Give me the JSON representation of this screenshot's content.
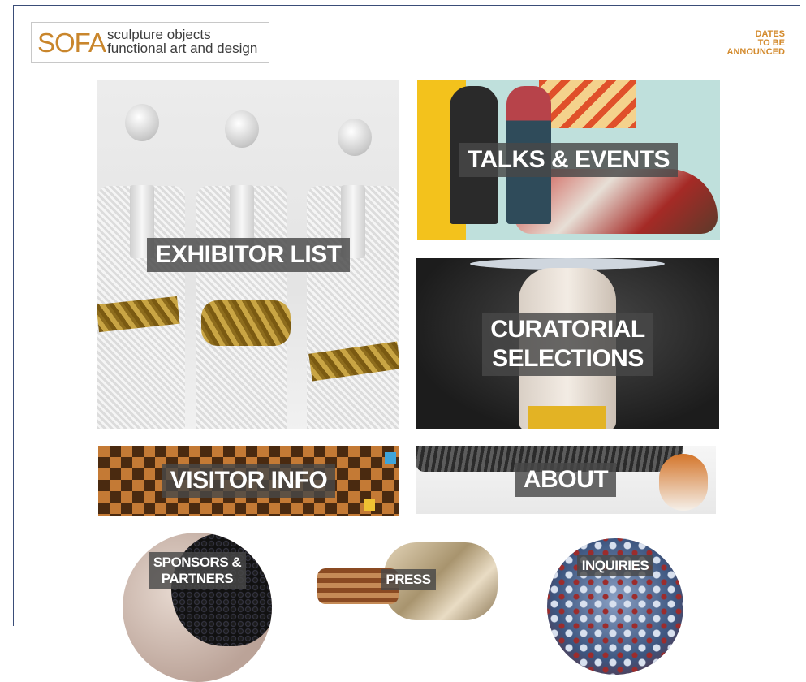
{
  "logo": {
    "mark": "SOFA",
    "tagline": "sculpture objects\nfunctional art and design"
  },
  "dates_notice": "DATES\nTO BE\nANNOUNCED",
  "tiles": {
    "exhibitor_list": "EXHIBITOR LIST",
    "talks_events": "TALKS & EVENTS",
    "curatorial_selections": "CURATORIAL\nSELECTIONS",
    "visitor_info": "VISITOR INFO",
    "about": "ABOUT",
    "sponsors_partners": "SPONSORS &\nPARTNERS",
    "press": "PRESS",
    "inquiries": "INQUIRIES"
  },
  "colors": {
    "brand_orange": "#c9862c",
    "label_bg": "#484848"
  }
}
